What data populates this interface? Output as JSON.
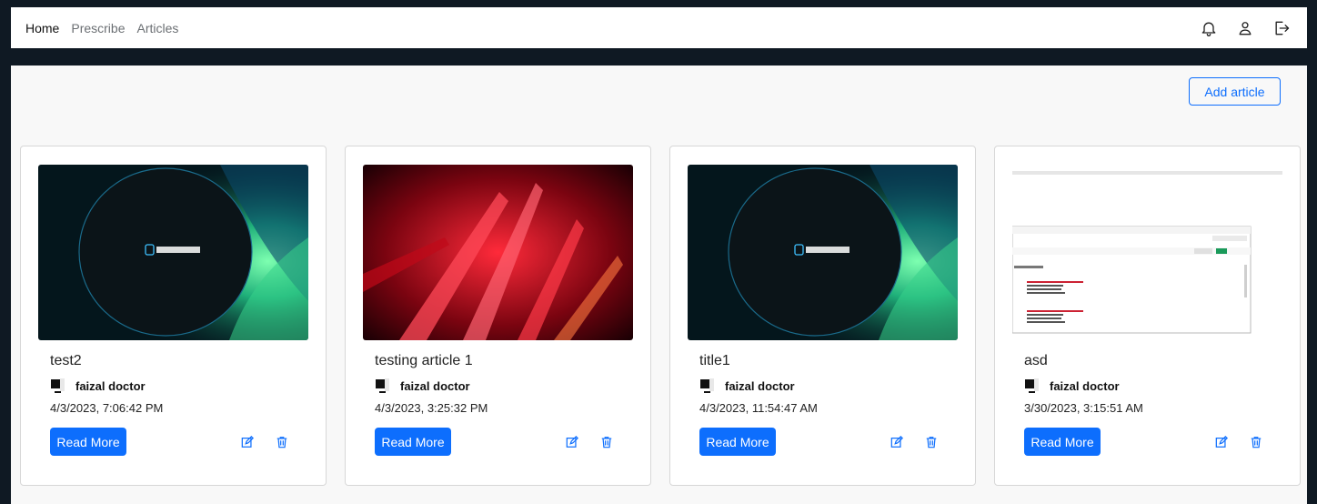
{
  "nav": {
    "links": [
      "Home",
      "Prescribe",
      "Articles"
    ],
    "icons": [
      "bell-icon",
      "user-icon",
      "logout-icon"
    ]
  },
  "main": {
    "add_article_label": "Add article",
    "cards": [
      {
        "title": "test2",
        "author": "faizal doctor",
        "date": "4/3/2023, 7:06:42 PM",
        "image": "planets",
        "read_more": "Read More"
      },
      {
        "title": "testing article 1",
        "author": "faizal doctor",
        "date": "4/3/2023, 3:25:32 PM",
        "image": "red-abstract",
        "read_more": "Read More"
      },
      {
        "title": "title1",
        "author": "faizal doctor",
        "date": "4/3/2023, 11:54:47 AM",
        "image": "planets",
        "read_more": "Read More"
      },
      {
        "title": "asd",
        "author": "faizal doctor",
        "date": "3/30/2023, 3:15:51 AM",
        "image": "database-screenshot",
        "read_more": "Read More"
      }
    ]
  },
  "colors": {
    "accent": "#0d6efd",
    "page_bg": "#0f1923",
    "content_bg": "#f8f8f8"
  }
}
